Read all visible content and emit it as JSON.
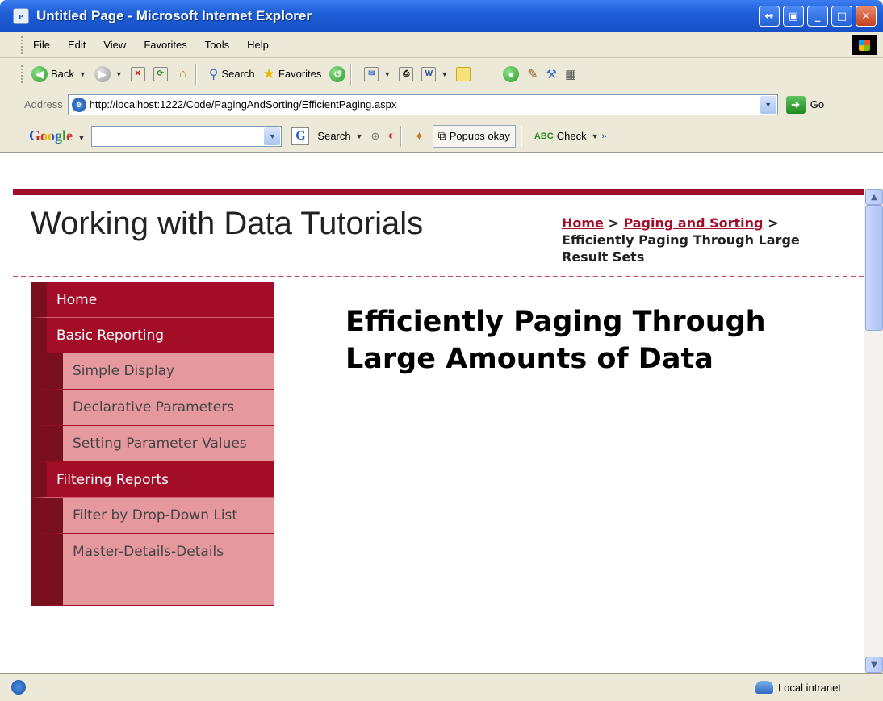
{
  "window": {
    "title": "Untitled Page - Microsoft Internet Explorer",
    "controls": [
      "help-button",
      "restore-button",
      "minimize-button",
      "maximize-button",
      "close-button"
    ]
  },
  "menubar": {
    "items": [
      "File",
      "Edit",
      "View",
      "Favorites",
      "Tools",
      "Help"
    ]
  },
  "toolbar": {
    "back_label": "Back",
    "search_label": "Search",
    "favorites_label": "Favorites"
  },
  "address": {
    "label": "Address",
    "url": "http://localhost:1222/Code/PagingAndSorting/EfficientPaging.aspx",
    "go_label": "Go"
  },
  "google": {
    "logo": "Google",
    "search_value": "",
    "search_label": "Search",
    "popups_label": "Popups okay",
    "check_label": "Check"
  },
  "page": {
    "site_title": "Working with Data Tutorials",
    "breadcrumb": {
      "home": "Home",
      "sep1": " > ",
      "section": "Paging and Sorting",
      "sep2": " >",
      "current": "Efficiently Paging Through Large Result Sets"
    },
    "heading": "Efficiently Paging Through Large Amounts of Data",
    "nav": [
      {
        "label": "Home",
        "level": "top"
      },
      {
        "label": "Basic Reporting",
        "level": "top"
      },
      {
        "label": "Simple Display",
        "level": "sub"
      },
      {
        "label": "Declarative Parameters",
        "level": "sub"
      },
      {
        "label": "Setting Parameter Values",
        "level": "sub"
      },
      {
        "label": "Filtering Reports",
        "level": "top"
      },
      {
        "label": "Filter by Drop-Down List",
        "level": "sub"
      },
      {
        "label": "Master-Details-Details",
        "level": "sub"
      },
      {
        "label": "",
        "level": "sub"
      }
    ]
  },
  "statusbar": {
    "zone": "Local intranet"
  },
  "colors": {
    "brand": "#a30d28",
    "nav_dark": "#7a0f1f",
    "nav_sub_bg": "#e5989d",
    "xp_blue": "#1f5fd8"
  }
}
